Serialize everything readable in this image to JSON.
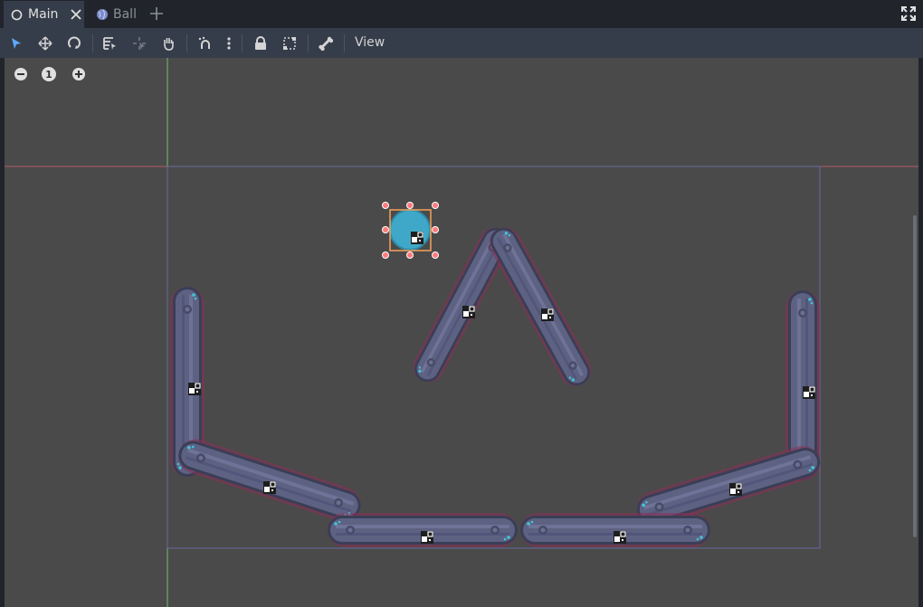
{
  "tabs": [
    {
      "label": "Main",
      "icon": "node-circle-icon",
      "active": true
    },
    {
      "label": "Ball",
      "icon": "globe-icon",
      "active": false
    }
  ],
  "toolbar": {
    "view_label": "View"
  },
  "viewport": {
    "zoom_label": "1"
  },
  "colors": {
    "accent": "#5fa9ff",
    "bar": "#5a5f7d",
    "bar_stripe": "#6b7090",
    "bar_outline": "#3a3e56",
    "ball": "#3fa8c9",
    "selection": "#f5a25a",
    "handle": "#ff7a7a"
  }
}
